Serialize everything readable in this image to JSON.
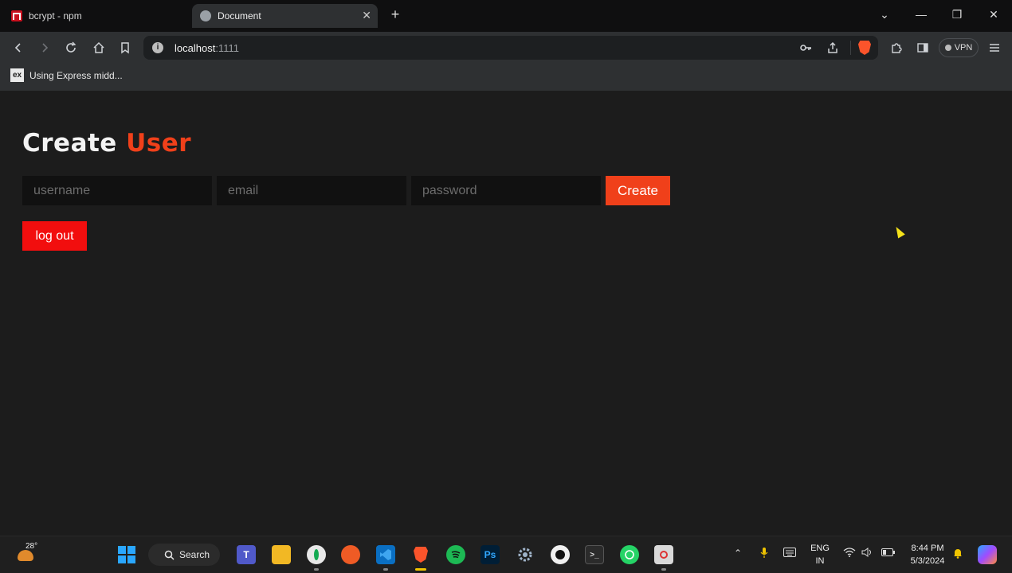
{
  "browser": {
    "tabs": [
      {
        "title": "bcrypt - npm",
        "icon": "npm-icon",
        "active": false
      },
      {
        "title": "Document",
        "icon": "globe-icon",
        "active": true
      }
    ],
    "new_tab_glyph": "+",
    "address": {
      "host": "localhost",
      "port": ":1111"
    },
    "vpn_label": "VPN",
    "bookmarks": [
      {
        "icon_text": "ex",
        "label": "Using Express midd..."
      }
    ]
  },
  "page": {
    "title_main": "Create",
    "title_accent": "User",
    "accent_color": "#f0401a",
    "form": {
      "username_placeholder": "username",
      "email_placeholder": "email",
      "password_placeholder": "password",
      "create_label": "Create"
    },
    "logout_label": "log out",
    "logout_color": "#f20e0e"
  },
  "taskbar": {
    "weather_temp": "28°",
    "search_label": "Search",
    "apps": [
      "windows-start-icon",
      "teams-icon",
      "file-explorer-icon",
      "mongodb-compass-icon",
      "postman-icon",
      "vscode-icon",
      "brave-icon",
      "spotify-icon",
      "photoshop-icon",
      "settings-icon",
      "github-icon",
      "terminal-icon",
      "whatsapp-icon",
      "snipping-tool-icon"
    ],
    "photoshop_text": "Ps",
    "lang_line1": "ENG",
    "lang_line2": "IN",
    "time": "8:44 PM",
    "date": "5/3/2024"
  }
}
